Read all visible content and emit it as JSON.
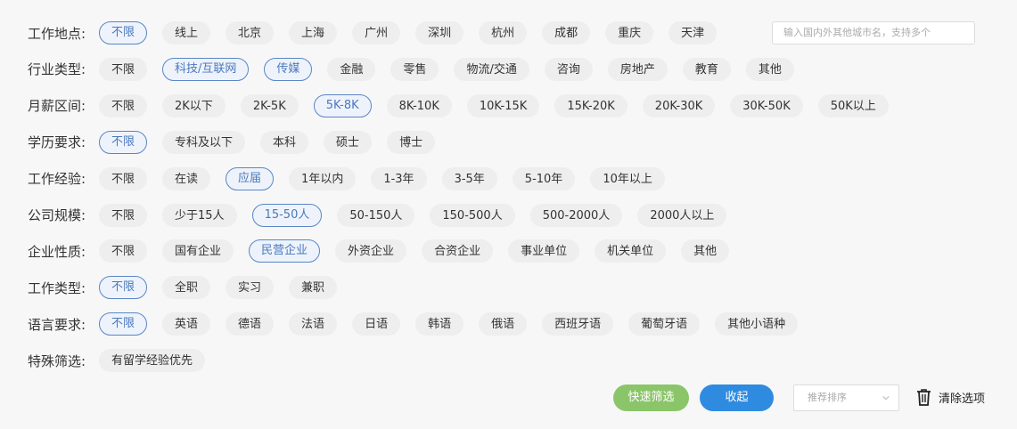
{
  "filters": [
    {
      "label": "工作地点:",
      "options": [
        "不限",
        "线上",
        "北京",
        "上海",
        "广州",
        "深圳",
        "杭州",
        "成都",
        "重庆",
        "天津"
      ],
      "selected": [
        0
      ]
    },
    {
      "label": "行业类型:",
      "options": [
        "不限",
        "科技/互联网",
        "传媒",
        "金融",
        "零售",
        "物流/交通",
        "咨询",
        "房地产",
        "教育",
        "其他"
      ],
      "selected": [
        1,
        2
      ]
    },
    {
      "label": "月薪区间:",
      "options": [
        "不限",
        "2K以下",
        "2K-5K",
        "5K-8K",
        "8K-10K",
        "10K-15K",
        "15K-20K",
        "20K-30K",
        "30K-50K",
        "50K以上"
      ],
      "selected": [
        3
      ]
    },
    {
      "label": "学历要求:",
      "options": [
        "不限",
        "专科及以下",
        "本科",
        "硕士",
        "博士"
      ],
      "selected": [
        0
      ]
    },
    {
      "label": "工作经验:",
      "options": [
        "不限",
        "在读",
        "应届",
        "1年以内",
        "1-3年",
        "3-5年",
        "5-10年",
        "10年以上"
      ],
      "selected": [
        2
      ]
    },
    {
      "label": "公司规模:",
      "options": [
        "不限",
        "少于15人",
        "15-50人",
        "50-150人",
        "150-500人",
        "500-2000人",
        "2000人以上"
      ],
      "selected": [
        2
      ]
    },
    {
      "label": "企业性质:",
      "options": [
        "不限",
        "国有企业",
        "民营企业",
        "外资企业",
        "合资企业",
        "事业单位",
        "机关单位",
        "其他"
      ],
      "selected": [
        2
      ]
    },
    {
      "label": "工作类型:",
      "options": [
        "不限",
        "全职",
        "实习",
        "兼职"
      ],
      "selected": [
        0
      ]
    },
    {
      "label": "语言要求:",
      "options": [
        "不限",
        "英语",
        "德语",
        "法语",
        "日语",
        "韩语",
        "俄语",
        "西班牙语",
        "葡萄牙语",
        "其他小语种"
      ],
      "selected": [
        0
      ]
    },
    {
      "label": "特殊筛选:",
      "options": [
        "有留学经验优先"
      ],
      "selected": []
    }
  ],
  "city_input": {
    "placeholder": "输入国内外其他城市名，支持多个",
    "value": ""
  },
  "actions": {
    "quick_filter": "快速筛选",
    "collapse": "收起",
    "sort_placeholder": "推荐排序",
    "clear": "清除选项"
  },
  "colors": {
    "accent": "#4a78bd",
    "quick_filter_bg": "#8bc56a",
    "collapse_bg": "#2f8be0",
    "chip_bg": "#eeeeef"
  }
}
